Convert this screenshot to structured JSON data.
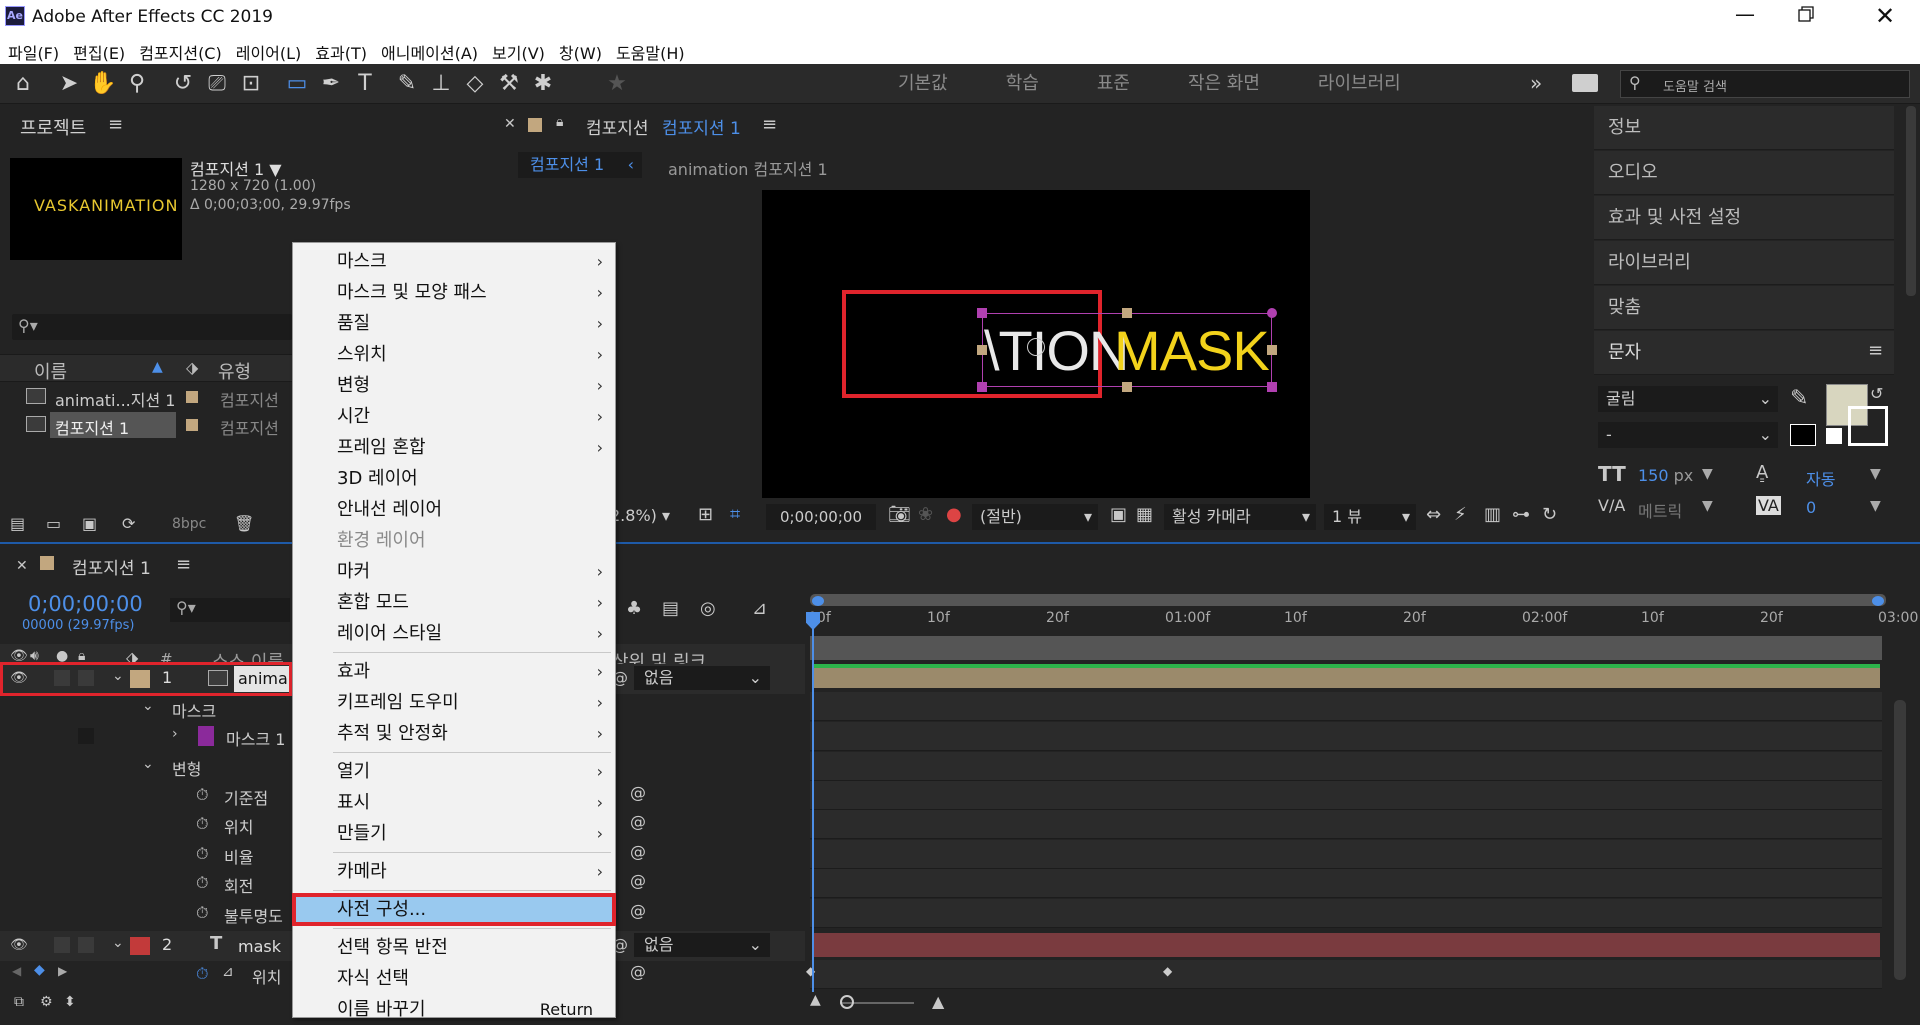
{
  "app": {
    "title": "Adobe After Effects CC 2019",
    "logo": "Ae"
  },
  "menu": [
    "파일(F)",
    "편집(E)",
    "컴포지션(C)",
    "레이어(L)",
    "효과(T)",
    "애니메이션(A)",
    "보기(V)",
    "창(W)",
    "도움말(H)"
  ],
  "workspaces": [
    "기본값",
    "학습",
    "표준",
    "작은 화면",
    "라이브러리"
  ],
  "help_search": {
    "placeholder": "도움말 검색"
  },
  "project": {
    "title": "프로젝트",
    "preview_text": "VASKANIMATION",
    "comp_name": "컴포지션 1 ▼",
    "comp_info1": "1280 x 720 (1.00)",
    "comp_info2": "Δ 0;00;03;00, 29.97fps",
    "col_name": "이름",
    "col_type": "유형",
    "items": [
      {
        "name": "animati...지션 1",
        "type": "컴포지션"
      },
      {
        "name": "컴포지션 1",
        "type": "컴포지션"
      }
    ],
    "bpc": "8bpc"
  },
  "viewer": {
    "tab_prefix": "컴포지션",
    "tab_name": "컴포지션 1",
    "breadcrumb1": "컴포지션 1",
    "breadcrumb2": "animation 컴포지션 1",
    "canvas_white": "\\TION",
    "canvas_yellow": "MASK",
    "zoom": "2.8%)",
    "timecode": "0;00;00;00",
    "resolution": "(절반)",
    "camera": "활성 카메라",
    "views": "1 뷰",
    "colors": {
      "yellow": "#f2d21b",
      "highlight": "#e0242c"
    }
  },
  "right_panel": {
    "items": [
      "정보",
      "오디오",
      "효과 및 사전 설정",
      "라이브러리",
      "맞춤",
      "문자"
    ],
    "font": "굴림",
    "style": "-",
    "size": "150",
    "size_unit": "px",
    "leading": "자동",
    "kerning": "메트릭",
    "tracking": "0"
  },
  "timeline": {
    "tab": "컴포지션 1",
    "timecode": "0;00;00;00",
    "frames": "00000 (29.97fps)",
    "col_num": "#",
    "col_source": "소스 이름",
    "col_parent": "상위 및 링크",
    "ruler": [
      "00f",
      "10f",
      "20f",
      "01:00f",
      "10f",
      "20f",
      "02:00f",
      "10f",
      "20f",
      "03:00"
    ],
    "layers": [
      {
        "num": "1",
        "name": "anima",
        "parent": "없음"
      },
      {
        "num": "2",
        "name": "mask",
        "parent": "없음"
      }
    ],
    "props": {
      "mask_group": "마스크",
      "mask1": "마스크 1",
      "transform": "변형",
      "anchor": "기준점",
      "position": "위치",
      "scale": "비율",
      "rotation": "회전",
      "opacity": "불투명도",
      "pos2": "위치"
    }
  },
  "context_menu": {
    "items": [
      {
        "label": "마스크",
        "arrow": true
      },
      {
        "label": "마스크 및 모양 패스",
        "arrow": true
      },
      {
        "label": "품질",
        "arrow": true
      },
      {
        "label": "스위치",
        "arrow": true
      },
      {
        "label": "변형",
        "arrow": true
      },
      {
        "label": "시간",
        "arrow": true
      },
      {
        "label": "프레임 혼합",
        "arrow": true
      },
      {
        "label": "3D 레이어",
        "arrow": false
      },
      {
        "label": "안내선 레이어",
        "arrow": false
      },
      {
        "label": "환경 레이어",
        "arrow": false,
        "disabled": true
      },
      {
        "label": "마커",
        "arrow": true
      },
      {
        "label": "혼합 모드",
        "arrow": true
      },
      {
        "label": "레이어 스타일",
        "arrow": true
      },
      {
        "label": "효과",
        "arrow": true
      },
      {
        "label": "키프레임 도우미",
        "arrow": true
      },
      {
        "label": "추적 및 안정화",
        "arrow": true
      },
      {
        "label": "열기",
        "arrow": true
      },
      {
        "label": "표시",
        "arrow": true
      },
      {
        "label": "만들기",
        "arrow": true
      },
      {
        "label": "카메라",
        "arrow": true
      },
      {
        "label": "사전 구성...",
        "arrow": false,
        "highlighted": true
      },
      {
        "label": "선택 항목 반전",
        "arrow": false
      },
      {
        "label": "자식 선택",
        "arrow": false
      },
      {
        "label": "이름 바꾸기",
        "arrow": false,
        "shortcut": "Return"
      }
    ]
  }
}
